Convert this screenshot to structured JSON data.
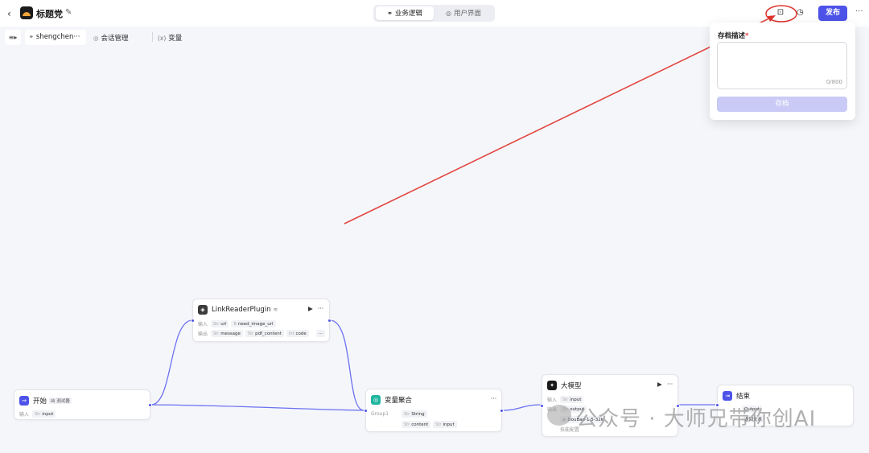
{
  "header": {
    "back_icon": "chevron-left-icon",
    "app_title": "标题党",
    "tabs": [
      {
        "label": "业务逻辑",
        "icon": "workflow-icon",
        "active": true
      },
      {
        "label": "用户界面",
        "icon": "palette-icon",
        "active": false
      }
    ],
    "publish_label": "发布",
    "accent_color": "#4d53e8"
  },
  "toolbar": {
    "workflow_name": "shengchen···",
    "conversation_label": "会话管理",
    "variables_label": "变量"
  },
  "archive_popover": {
    "label": "存档描述",
    "required_mark": "*",
    "counter": "0/800",
    "save_label": "存档"
  },
  "nodes": {
    "start": {
      "title": "开始",
      "badge": "凶 测试器",
      "input_label": "输入",
      "input_value": "input"
    },
    "plugin": {
      "title": "LinkReaderPlugin",
      "input_label": "输入",
      "inputs": [
        "url",
        "need_image_url"
      ],
      "output_label": "输出",
      "outputs": [
        "message",
        "pdf_content",
        "code"
      ]
    },
    "aggregate": {
      "title": "变量聚合",
      "group_label": "Group1",
      "type_label": "String",
      "items": [
        "content",
        "input"
      ]
    },
    "llm": {
      "title": "大模型",
      "input_label": "输入",
      "input_value": "input",
      "output_label": "输出",
      "output_value": "output",
      "model": "DouBao-1.5-32k",
      "skill_label": "技能配置"
    },
    "end": {
      "title": "结束",
      "param_label": "Output",
      "return_label": "返回文本"
    }
  },
  "watermark": "公众号 · 大师兄带你创AI"
}
